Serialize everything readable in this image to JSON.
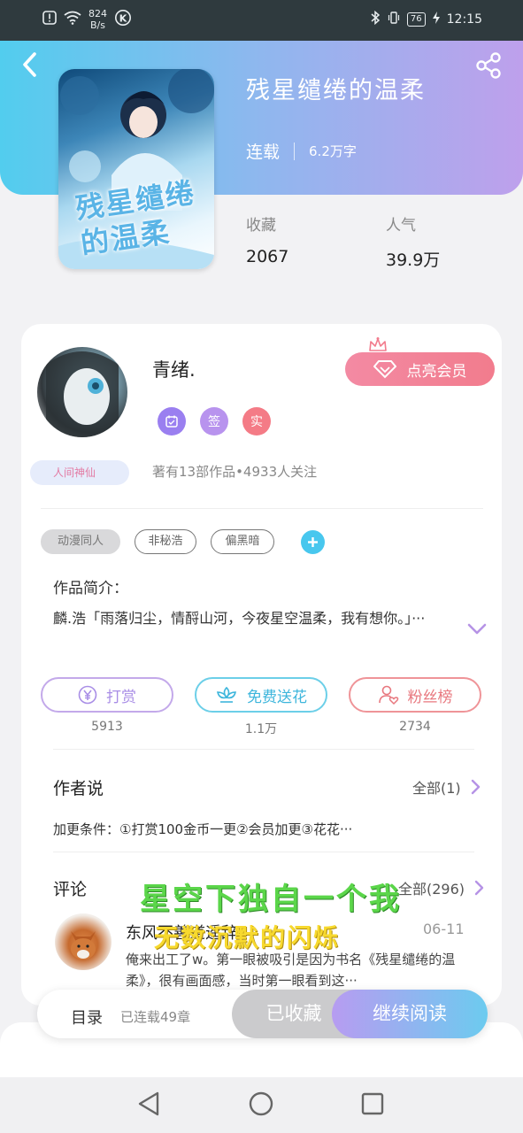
{
  "status_bar": {
    "net_speed_value": "824",
    "net_speed_unit": "B/s",
    "battery": "76",
    "time": "12:15"
  },
  "book": {
    "title": "残星缱绻的温柔",
    "cover_title": "残星缱绻的温柔",
    "status": "连载",
    "word_count": "6.2万字",
    "stats": [
      {
        "label": "收藏",
        "value": "2067"
      },
      {
        "label": "人气",
        "value": "39.9万"
      }
    ]
  },
  "author": {
    "name": "青绪.",
    "badge_text": "人间神仙",
    "stats": "著有13部作品•4933人关注",
    "badges": [
      {
        "icon": "calendar-icon",
        "text": ""
      },
      {
        "icon": "sign-icon",
        "text": "签"
      },
      {
        "icon": "verified-icon",
        "text": "实"
      }
    ],
    "vip_button": "点亮会员"
  },
  "tags": [
    "动漫同人",
    "非秘浩",
    "偏黑暗"
  ],
  "intro": {
    "label": "作品简介：",
    "text": "麟.浩「雨落归尘，情酹山河，今夜星空温柔，我有想你。」···"
  },
  "actions": [
    {
      "label": "打赏",
      "count": "5913",
      "icon": "yen-icon"
    },
    {
      "label": "免费送花",
      "count": "1.1万",
      "icon": "flower-icon"
    },
    {
      "label": "粉丝榜",
      "count": "2734",
      "icon": "fan-icon"
    }
  ],
  "author_says": {
    "title": "作者说",
    "link": "全部(1)",
    "text": "加更条件：①打赏100金币一更②会员加更③花花···"
  },
  "comments": {
    "title": "评论",
    "link": "全部(296)",
    "items": [
      {
        "user": "东风不善道遥辞",
        "date": "06-11",
        "text": "俺来出工了w。第一眼被吸引是因为书名《残星缱绻的温柔》，很有画面感，当时第一眼看到这···"
      }
    ]
  },
  "overlay": {
    "line1": "星空下独自一个我",
    "line2": "无数沉默的闪烁"
  },
  "bottom_bar": {
    "toc": "目录",
    "toc_sub": "已连载49章",
    "collected": "已收藏",
    "read": "继续阅读"
  },
  "colors": {
    "hero_gradient": [
      "#52cdee",
      "#bea0ec"
    ],
    "vip": "#f27c8d",
    "accent_blue": "#48c7ee"
  }
}
